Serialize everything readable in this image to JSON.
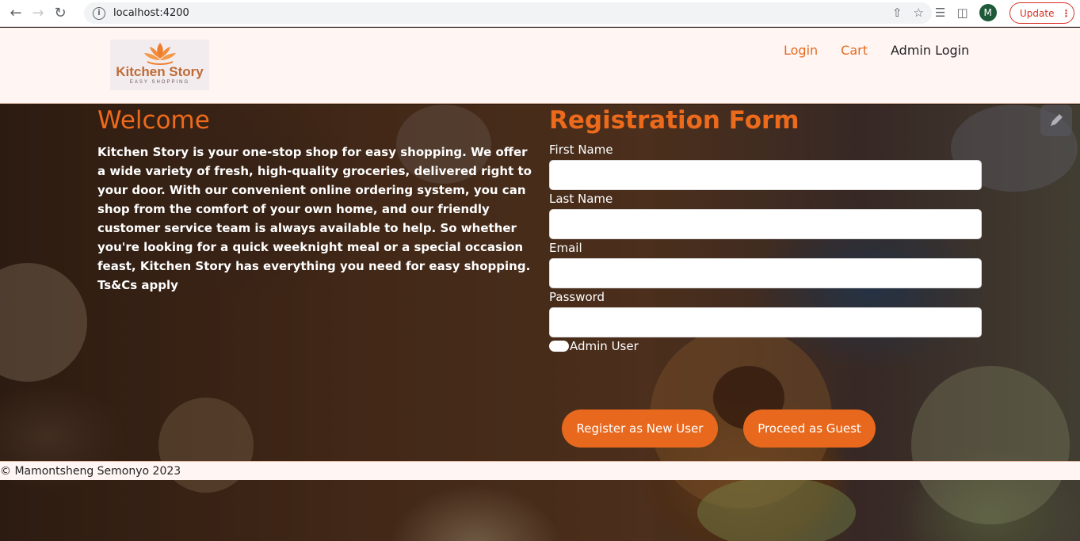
{
  "browser": {
    "url": "localhost:4200",
    "avatar_letter": "M",
    "update_label": "Update"
  },
  "header": {
    "logo_title": "Kitchen Story",
    "logo_subtitle": "EASY SHOPPING",
    "nav": {
      "login": "Login",
      "cart": "Cart",
      "admin_login": "Admin Login"
    }
  },
  "welcome": {
    "title": "Welcome",
    "body": "Kitchen Story is your one-stop shop for easy shopping. We offer a wide variety of fresh, high-quality groceries, delivered right to your door. With our convenient online ordering system, you can shop from the comfort of your own home, and our friendly customer service team is always available to help. So whether you're looking for a quick weeknight meal or a special occasion feast, Kitchen Story has everything you need for easy shopping. Ts&Cs apply"
  },
  "form": {
    "title": "Registration Form",
    "first_name_label": "First Name",
    "first_name_value": "",
    "last_name_label": "Last Name",
    "last_name_value": "",
    "email_label": "Email",
    "email_value": "",
    "password_label": "Password",
    "password_value": "",
    "admin_user_label": "Admin User",
    "register_button": "Register as New User",
    "guest_button": "Proceed as Guest"
  },
  "footer": {
    "text": "© Mamontsheng Semonyo 2023"
  },
  "colors": {
    "accent": "#e8691e",
    "header_bg": "#fff6f4"
  }
}
